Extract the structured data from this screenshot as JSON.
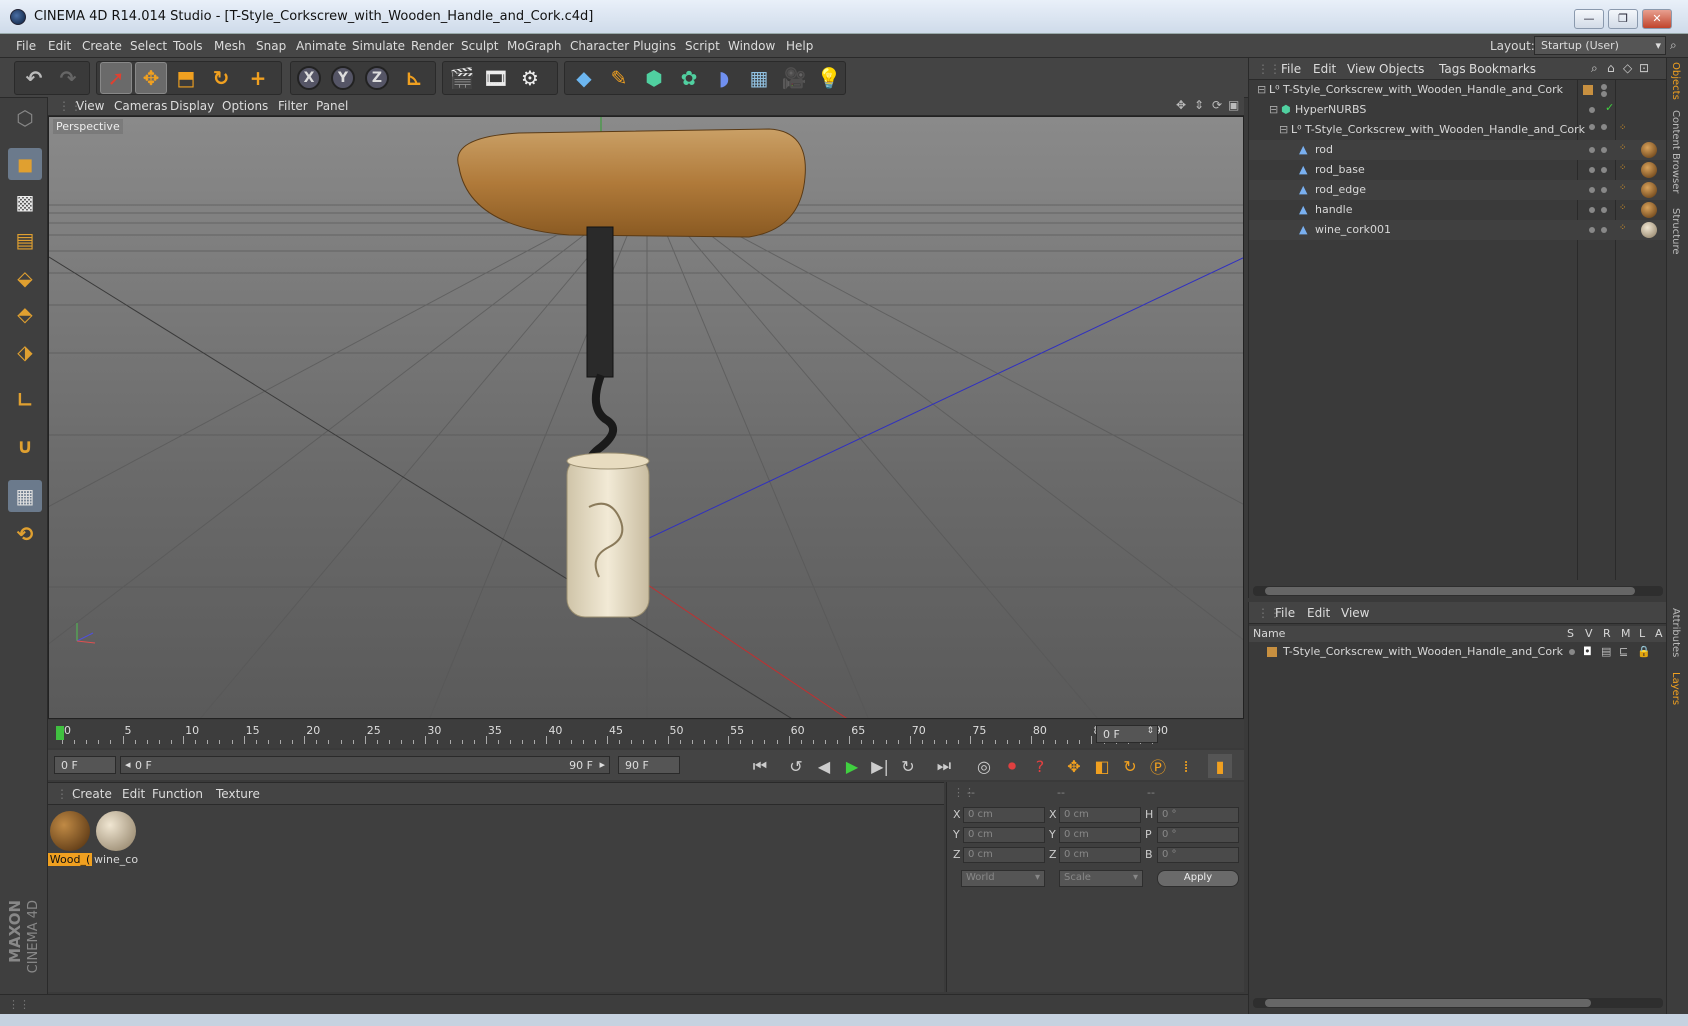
{
  "window": {
    "title": "CINEMA 4D R14.014 Studio - [T-Style_Corkscrew_with_Wooden_Handle_and_Cork.c4d]",
    "min": "—",
    "restore": "❐",
    "close": "✕"
  },
  "menubar": {
    "items": [
      "File",
      "Edit",
      "Create",
      "Select",
      "Tools",
      "Mesh",
      "Snap",
      "Animate",
      "Simulate",
      "Render",
      "Sculpt",
      "MoGraph",
      "Character",
      "Plugins",
      "Script",
      "Window",
      "Help"
    ],
    "layout_label": "Layout:",
    "layout_value": "Startup (User)"
  },
  "toolbar": {
    "icons": [
      "undo-icon",
      "redo-icon",
      "live-selection-icon",
      "move-icon",
      "scale-icon",
      "rotate-icon",
      "add-icon",
      "lock-x-icon",
      "lock-y-icon",
      "lock-z-icon",
      "coordinate-system-icon",
      "render-view-icon",
      "render-picture-viewer-icon",
      "render-settings-icon",
      "cube-icon",
      "spline-pen-icon",
      "nurbs-icon",
      "array-icon",
      "deformer-icon",
      "floor-icon",
      "camera-icon",
      "light-icon"
    ],
    "x": "X",
    "y": "Y",
    "z": "Z"
  },
  "viewport": {
    "menu": [
      "View",
      "Cameras",
      "Display",
      "Options",
      "Filter",
      "Panel"
    ],
    "label": "Perspective"
  },
  "timeline": {
    "ticks": [
      "0",
      "5",
      "10",
      "15",
      "20",
      "25",
      "30",
      "35",
      "40",
      "45",
      "50",
      "55",
      "60",
      "65",
      "70",
      "75",
      "80",
      "85",
      "90"
    ],
    "current_frame": "0 F"
  },
  "transport": {
    "start": "0 F",
    "range_start": "0 F",
    "range_end": "90 F",
    "end": "90 F"
  },
  "materials": {
    "menu": [
      "Create",
      "Edit",
      "Function",
      "Texture"
    ],
    "items": [
      {
        "label": "Wood_(",
        "color_a": "#c08a45",
        "color_b": "#4a2a0c"
      },
      {
        "label": "wine_co",
        "color_a": "#f0e6d2",
        "color_b": "#8a7a60"
      }
    ]
  },
  "coords": {
    "headers": [
      "--",
      "--",
      "--"
    ],
    "rows": [
      {
        "a": "X",
        "av": "0 cm",
        "b": "X",
        "bv": "0 cm",
        "c": "H",
        "cv": "0 °"
      },
      {
        "a": "Y",
        "av": "0 cm",
        "b": "Y",
        "bv": "0 cm",
        "c": "P",
        "cv": "0 °"
      },
      {
        "a": "Z",
        "av": "0 cm",
        "b": "Z",
        "bv": "0 cm",
        "c": "B",
        "cv": "0 °"
      }
    ],
    "world": "World",
    "scale": "Scale",
    "apply": "Apply"
  },
  "objects": {
    "menu": [
      "File",
      "Edit",
      "View",
      "Objects",
      "Tags",
      "Bookmarks"
    ],
    "tree": [
      {
        "name": "T-Style_Corkscrew_with_Wooden_Handle_and_Cork",
        "depth": 0
      },
      {
        "name": "HyperNURBS",
        "depth": 1
      },
      {
        "name": "T-Style_Corkscrew_with_Wooden_Handle_and_Cork",
        "depth": 2
      },
      {
        "name": "rod",
        "depth": 3
      },
      {
        "name": "rod_base",
        "depth": 3
      },
      {
        "name": "rod_edge",
        "depth": 3
      },
      {
        "name": "handle",
        "depth": 3
      },
      {
        "name": "wine_cork001",
        "depth": 3
      }
    ]
  },
  "layers": {
    "menu": [
      "File",
      "Edit",
      "View"
    ],
    "columns": [
      "Name",
      "S",
      "V",
      "R",
      "M",
      "L",
      "A"
    ],
    "rows": [
      "T-Style_Corkscrew_with_Wooden_Handle_and_Cork"
    ]
  },
  "side_tabs": [
    "Objects",
    "Content Browser",
    "Structure",
    "Attributes",
    "Layers"
  ],
  "brand": {
    "maxon": "MAXON",
    "product": "CINEMA 4D"
  }
}
